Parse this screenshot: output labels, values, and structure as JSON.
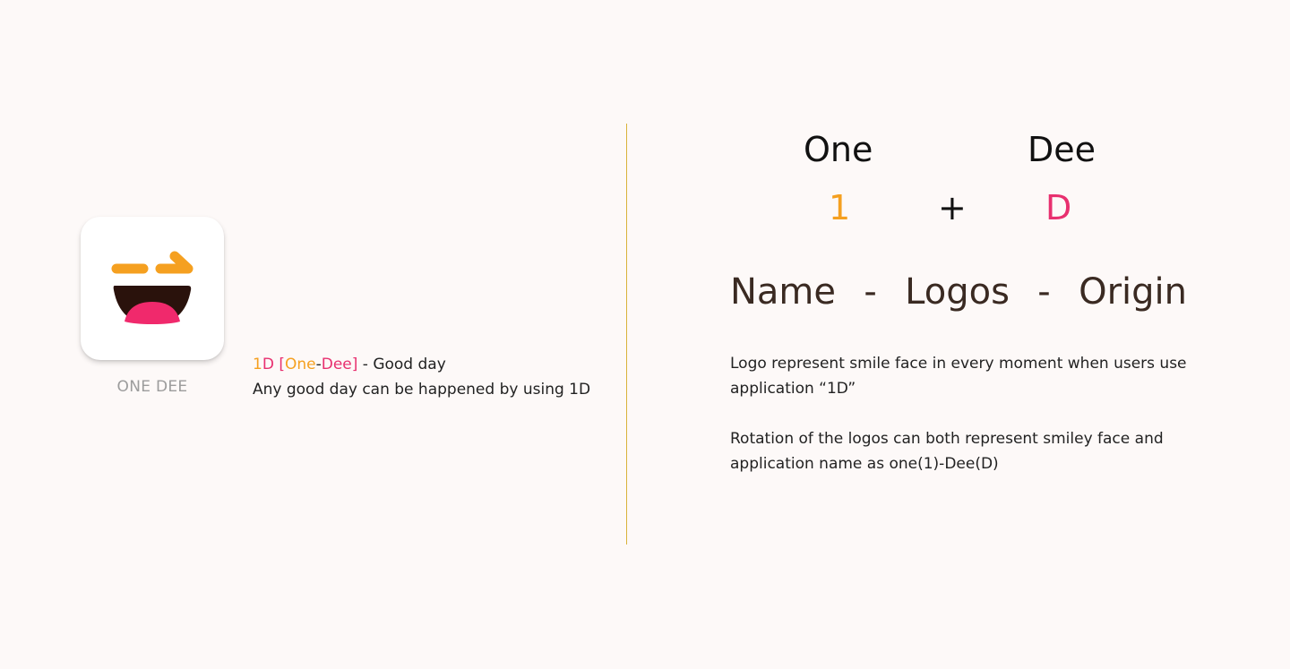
{
  "app": {
    "name": "ONE DEE",
    "icon": "smiley-logo-icon"
  },
  "tagline": {
    "one_d": "1D",
    "bracket_open": "[",
    "one": "One",
    "dash": "-",
    "dee": "Dee",
    "bracket_close": "]",
    "rest": " - Good day",
    "line2": "Any good day can be happened by using 1D"
  },
  "origin": {
    "word_one": "One",
    "word_dee": "Dee",
    "glyph_one": "1",
    "glyph_plus": "+",
    "glyph_d": "D"
  },
  "heading": {
    "name": "Name",
    "sep1": "-",
    "logos": "Logos",
    "sep2": "-",
    "origin": "Origin"
  },
  "description": {
    "p1": "Logo represent smile face in every moment when users use application “1D”",
    "p2": "Rotation of the logos can both represent smiley face and application name as one(1)-Dee(D)"
  },
  "colors": {
    "background": "#fdf9f8",
    "orange": "#f5a020",
    "pink": "#e8306f",
    "dark_brown": "#3a2a22",
    "mouth": "#2a120c",
    "divider": "#d9b33a"
  }
}
